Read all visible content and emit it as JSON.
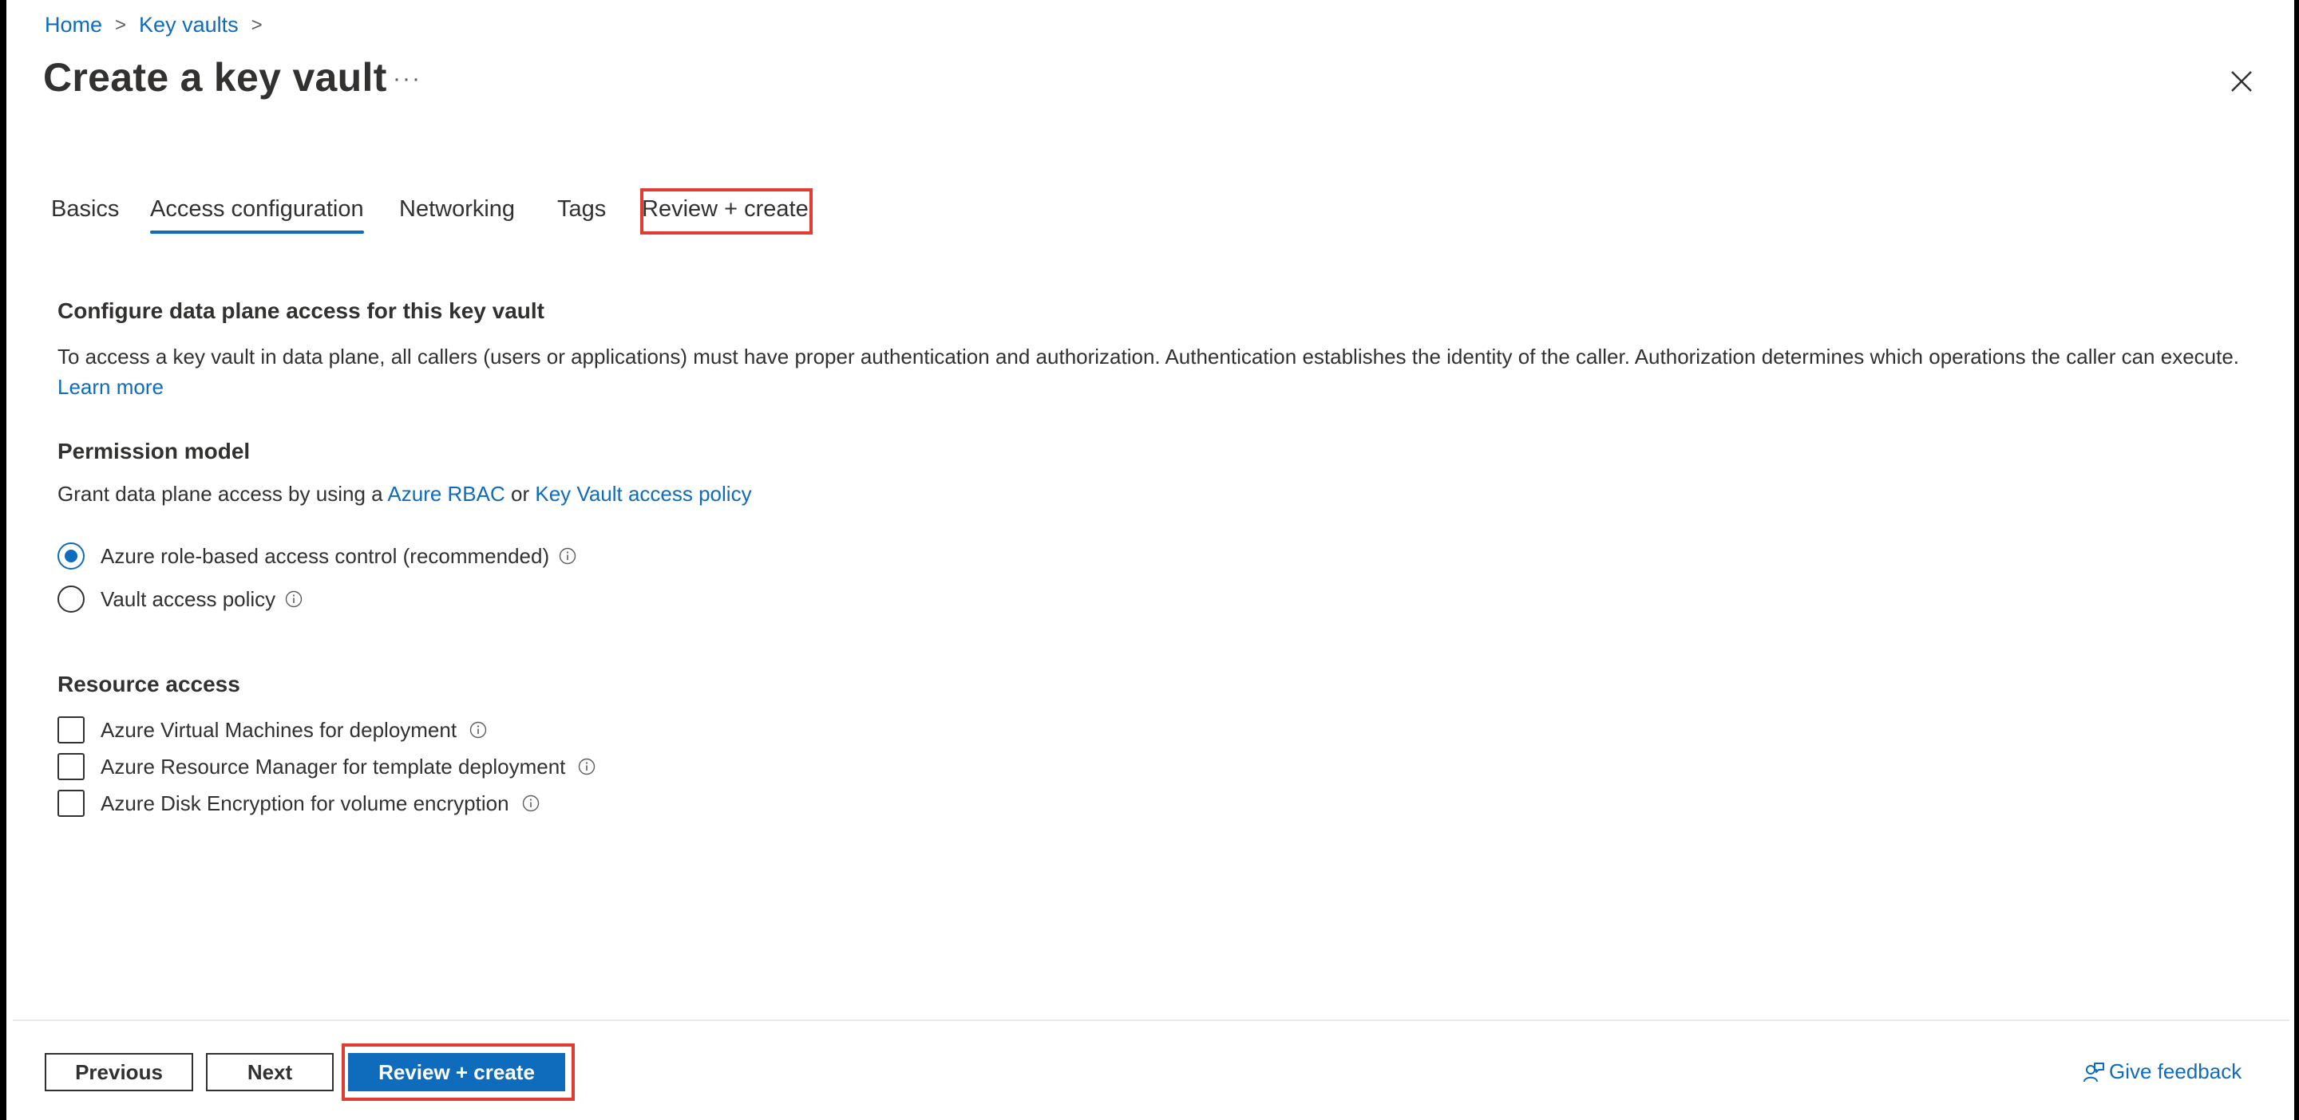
{
  "breadcrumb": {
    "items": [
      "Home",
      "Key vaults"
    ]
  },
  "page": {
    "title": "Create a key vault",
    "more_label": "···"
  },
  "tabs": [
    {
      "label": "Basics"
    },
    {
      "label": "Access configuration",
      "active": true
    },
    {
      "label": "Networking"
    },
    {
      "label": "Tags"
    },
    {
      "label": "Review + create"
    }
  ],
  "access": {
    "heading": "Configure data plane access for this key vault",
    "description": "To access a key vault in data plane, all callers (users or applications) must have proper authentication and authorization. Authentication establishes the identity of the caller. Authorization determines which operations the caller can execute.",
    "learn_more": "Learn more"
  },
  "permission_model": {
    "heading": "Permission model",
    "grant_prefix": "Grant data plane access by using a",
    "rbac_link": "Azure RBAC",
    "or_text": "or",
    "policy_link": "Key Vault access policy",
    "options": [
      {
        "label": "Azure role-based access control (recommended)",
        "selected": true
      },
      {
        "label": "Vault access policy",
        "selected": false
      }
    ]
  },
  "resource_access": {
    "heading": "Resource access",
    "options": [
      {
        "label": "Azure Virtual Machines for deployment",
        "checked": false
      },
      {
        "label": "Azure Resource Manager for template deployment",
        "checked": false
      },
      {
        "label": "Azure Disk Encryption for volume encryption",
        "checked": false
      }
    ]
  },
  "footer": {
    "previous_label": "Previous",
    "next_label": "Next",
    "review_label": "Review + create",
    "feedback_label": "Give feedback"
  },
  "colors": {
    "accent": "#0f6cbd",
    "highlight": "#e03c31",
    "text": "#323130"
  }
}
